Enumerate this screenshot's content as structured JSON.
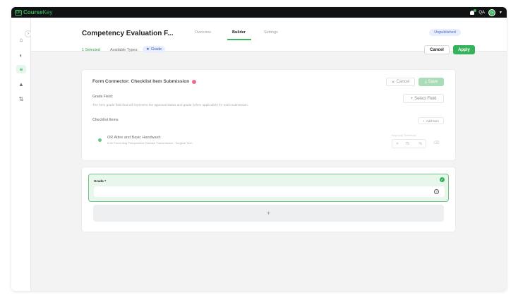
{
  "topbar": {
    "logo_mark": "CK",
    "logo_text_1": "Course",
    "logo_text_2": "Key",
    "user_initials": "QA",
    "avatar_initials": "CK"
  },
  "header": {
    "page_title": "Competency Evaluation F...",
    "tabs": [
      {
        "label": "Overview"
      },
      {
        "label": "Builder"
      },
      {
        "label": "Settings"
      }
    ],
    "status_badge": "Unpublished",
    "selected_count": "1 Selected",
    "available_types_label": "Available Types:",
    "type_chip": "Grade",
    "cancel_label": "Cancel",
    "apply_label": "Apply"
  },
  "connector_card": {
    "title": "Form Connector: Checklist Item Submission",
    "cancel_label": "Cancel",
    "save_label": "Save",
    "grade_field_label": "Grade Field:",
    "grade_field_description": "The form grade field that will represent the approval status and grade (when applicable) for each submission.",
    "select_field_label": "Select Field",
    "checklist_items_label": "Checklist Items",
    "add_item_label": "Add Item",
    "item": {
      "title": "OR Attire and Basic Handwash",
      "subtitle": "6.25 Preventing Perioperative Disease Transmission - Surgical Tech",
      "threshold_label": "Approval Threshold",
      "threshold_value": "75",
      "threshold_unit": "%"
    }
  },
  "grade_card": {
    "label": "Grade *",
    "value": "",
    "add_label": "+"
  },
  "colors": {
    "accent": "#34b35a",
    "topbar": "#111214",
    "badge_blue": "#4a67c9"
  }
}
